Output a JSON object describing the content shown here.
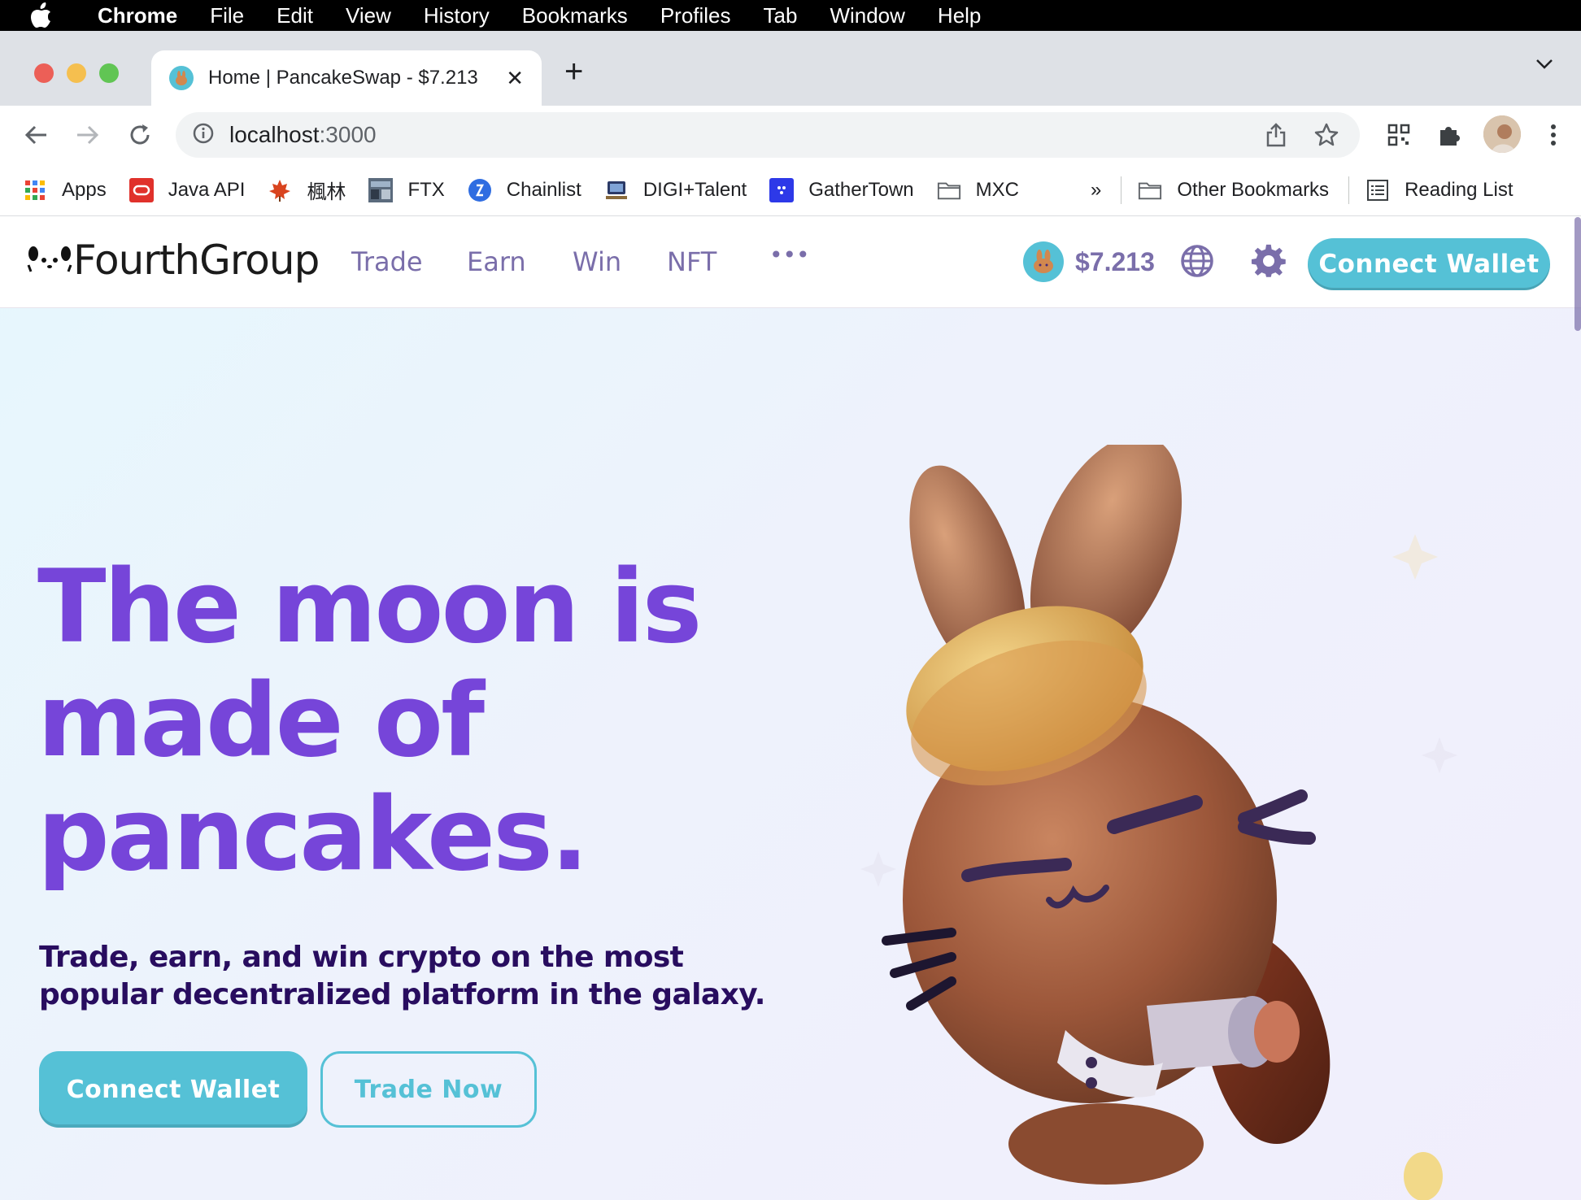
{
  "menubar": {
    "app_name": "Chrome",
    "items": [
      "File",
      "Edit",
      "View",
      "History",
      "Bookmarks",
      "Profiles",
      "Tab",
      "Window",
      "Help"
    ]
  },
  "browser": {
    "tab_title": "Home | PancakeSwap - $7.213",
    "url_host": "localhost",
    "url_port": ":3000",
    "bookmarks": [
      {
        "label": "Apps",
        "icon": "apps-grid-icon"
      },
      {
        "label": "Java API",
        "icon": "oracle-icon"
      },
      {
        "label": "楓林",
        "icon": "maple-leaf-icon"
      },
      {
        "label": "FTX",
        "icon": "ftx-icon"
      },
      {
        "label": "Chainlist",
        "icon": "chainlist-icon"
      },
      {
        "label": "DIGI+Talent",
        "icon": "digi-icon"
      },
      {
        "label": "GatherTown",
        "icon": "gathertown-icon"
      },
      {
        "label": "MXC",
        "icon": "folder-icon"
      }
    ],
    "overflow": "»",
    "other_bookmarks": "Other Bookmarks",
    "reading_list": "Reading List"
  },
  "site": {
    "logo_text": "FourthGroup",
    "nav": [
      "Trade",
      "Earn",
      "Win",
      "NFT"
    ],
    "more": "•••",
    "cake_price": "$7.213",
    "connect_wallet": "Connect Wallet"
  },
  "hero": {
    "title_lines": [
      "The moon is",
      "made of",
      "pancakes."
    ],
    "subtitle": "Trade, earn, and win crypto on the most popular decentralized platform in the galaxy.",
    "primary_button": "Connect Wallet",
    "secondary_button": "Trade Now"
  },
  "colors": {
    "primary": "#1FC7D4",
    "secondary": "#7645D9",
    "text_dark": "#280D5F",
    "nav_text": "#7A6EAA"
  }
}
